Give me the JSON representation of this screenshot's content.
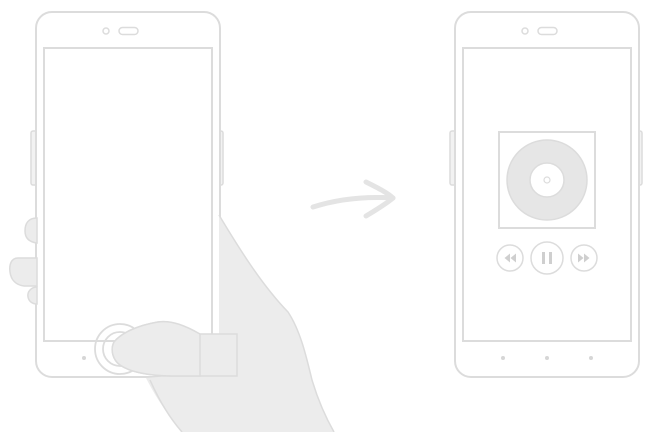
{
  "illustration": {
    "description_free": true,
    "colors": {
      "stroke": "#dcdcdc",
      "hand_fill": "#ececec",
      "disc_fill": "#e6e6e6",
      "screen_fill": "#ffffff",
      "arrow": "#e4e4e4",
      "control_icon": "#cfcfcf"
    },
    "icons": {
      "left_phone": "smartphone-icon",
      "right_phone": "smartphone-icon",
      "hand": "hand-pressing-icon",
      "arrow": "arrow-right-icon",
      "album": "music-disc-icon",
      "rewind": "rewind-icon",
      "pause": "pause-icon",
      "fast_forward": "fast-forward-icon"
    }
  }
}
